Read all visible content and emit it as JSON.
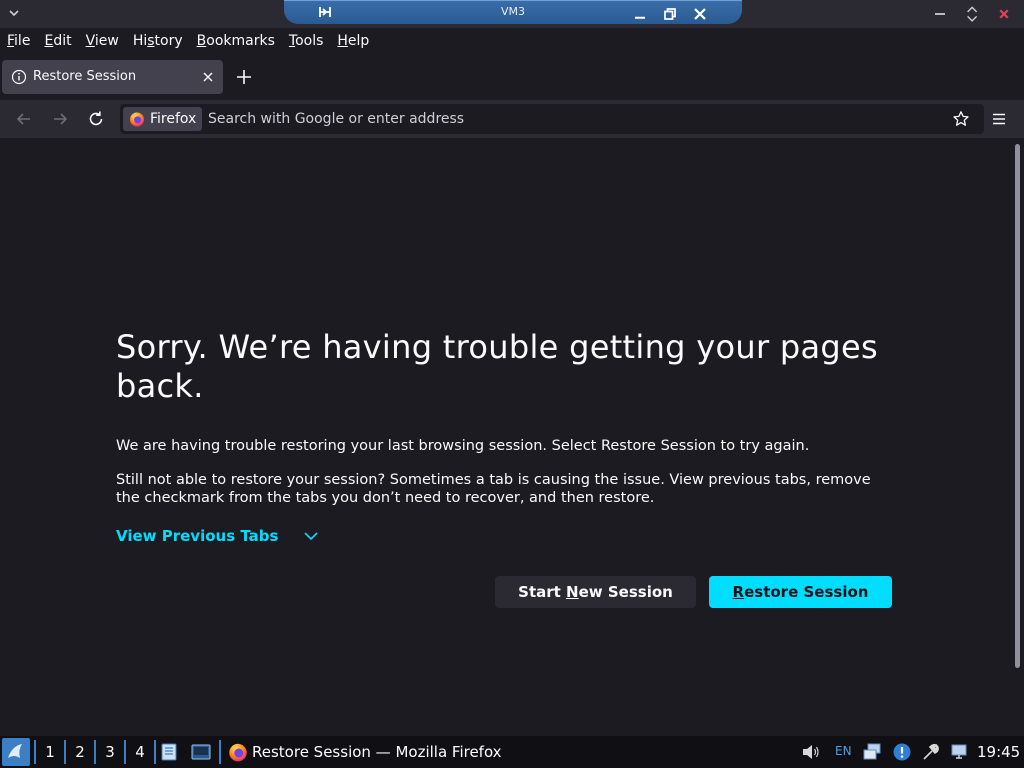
{
  "window": {
    "vm_title": "VM3"
  },
  "menubar": {
    "items": [
      {
        "label": "File",
        "underline": "F",
        "rest": "ile"
      },
      {
        "label": "Edit",
        "underline": "E",
        "rest": "dit"
      },
      {
        "label": "View",
        "underline": "V",
        "rest": "iew"
      },
      {
        "label": "History",
        "pre": "Hi",
        "underline": "s",
        "rest": "tory"
      },
      {
        "label": "Bookmarks",
        "underline": "B",
        "rest": "ookmarks"
      },
      {
        "label": "Tools",
        "underline": "T",
        "rest": "ools"
      },
      {
        "label": "Help",
        "underline": "H",
        "rest": "elp"
      }
    ]
  },
  "tabs": {
    "active_tab_title": "Restore Session"
  },
  "urlbar": {
    "identity_label": "Firefox",
    "placeholder": "Search with Google or enter address"
  },
  "page": {
    "headline": "Sorry. We’re having trouble getting your pages back.",
    "paragraph1": "We are having trouble restoring your last browsing session. Select Restore Session to try again.",
    "paragraph2": "Still not able to restore your session? Sometimes a tab is causing the issue. View previous tabs, remove the checkmark from the tabs you don’t need to recover, and then restore.",
    "view_previous_tabs": "View Previous Tabs",
    "start_new_session": {
      "pre": "Start ",
      "underline": "N",
      "rest": "ew Session"
    },
    "restore_session": {
      "pre": "",
      "underline": "R",
      "rest": "estore Session"
    }
  },
  "taskbar": {
    "workspaces": [
      "1",
      "2",
      "3",
      "4"
    ],
    "task_label": "Restore Session — Mozilla Firefox",
    "language": "EN",
    "clock": "19:45"
  },
  "colors": {
    "accent": "#00ddff",
    "background": "#1c1b22",
    "toolbar": "#2b2a33"
  }
}
